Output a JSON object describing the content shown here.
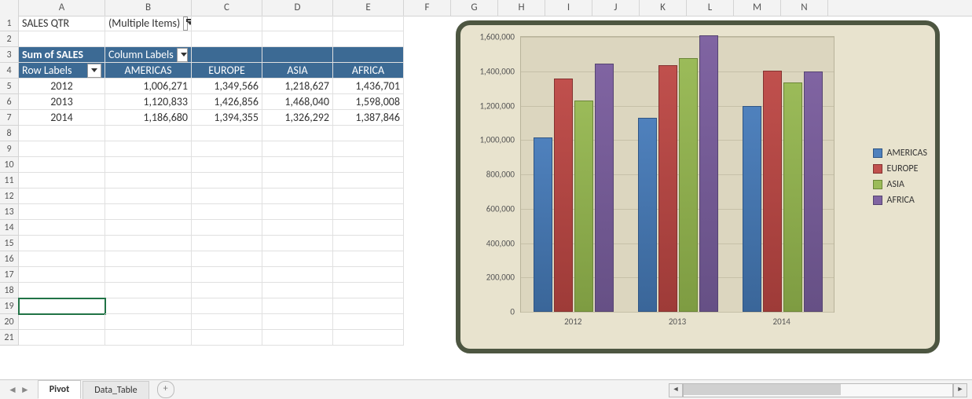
{
  "columns": [
    "A",
    "B",
    "C",
    "D",
    "E",
    "F",
    "G",
    "H",
    "I",
    "J",
    "K",
    "L",
    "M",
    "N"
  ],
  "filter": {
    "label": "SALES QTR",
    "value": "(Multiple Items)"
  },
  "pivot": {
    "sumLabel": "Sum of SALES",
    "colLabel": "Column Labels",
    "rowLabel": "Row Labels",
    "cols": [
      "AMERICAS",
      "EUROPE",
      "ASIA",
      "AFRICA"
    ],
    "rows": [
      "2012",
      "2013",
      "2014"
    ],
    "data": [
      [
        "1,006,271",
        "1,349,566",
        "1,218,627",
        "1,436,701"
      ],
      [
        "1,120,833",
        "1,426,856",
        "1,468,040",
        "1,598,008"
      ],
      [
        "1,186,680",
        "1,394,355",
        "1,326,292",
        "1,387,846"
      ]
    ]
  },
  "tabs": {
    "active": "Pivot",
    "others": [
      "Data_Table"
    ]
  },
  "chart_data": {
    "type": "bar",
    "categories": [
      "2012",
      "2013",
      "2014"
    ],
    "series": [
      {
        "name": "AMERICAS",
        "values": [
          1006271,
          1120833,
          1186680
        ],
        "color": "#4f81bd"
      },
      {
        "name": "EUROPE",
        "values": [
          1349566,
          1426856,
          1394355
        ],
        "color": "#c0504d"
      },
      {
        "name": "ASIA",
        "values": [
          1218627,
          1468040,
          1326292
        ],
        "color": "#9bbb59"
      },
      {
        "name": "AFRICA",
        "values": [
          1436701,
          1598008,
          1387846
        ],
        "color": "#8064a2"
      }
    ],
    "ylim": [
      0,
      1600000
    ],
    "yticks": [
      "0",
      "200,000",
      "400,000",
      "600,000",
      "800,000",
      "1,000,000",
      "1,200,000",
      "1,400,000",
      "1,600,000"
    ],
    "title": "",
    "xlabel": "",
    "ylabel": ""
  }
}
